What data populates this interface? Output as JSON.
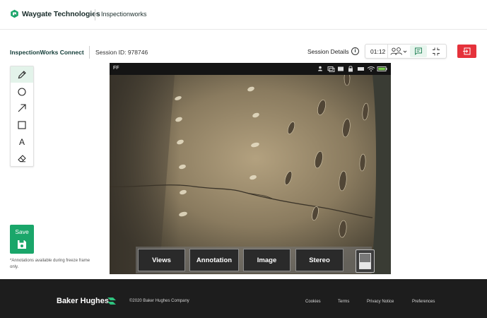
{
  "header": {
    "brand": "Waygate Technologies",
    "app_name": "Inspectionworks"
  },
  "session": {
    "title": "InspectionWorks Connect",
    "session_id": "Session ID: 978746",
    "details_label": "Session Details",
    "timer": "01:12"
  },
  "tools": [
    {
      "icon": "pencil-icon",
      "active": true
    },
    {
      "icon": "circle-icon"
    },
    {
      "icon": "arrow-icon"
    },
    {
      "icon": "rectangle-icon"
    },
    {
      "icon": "text-icon",
      "label": "A"
    },
    {
      "icon": "eraser-icon"
    }
  ],
  "save": {
    "label": "Save",
    "note": "*Annotations available during freeze frame only."
  },
  "video": {
    "status_text": "FF",
    "menu": [
      "Views",
      "Annotation",
      "Image",
      "Stereo"
    ]
  },
  "footer": {
    "brand": "Baker Hughes",
    "copyright": "©2020 Baker Hughes Company",
    "links": [
      "Cookies",
      "Terms",
      "Privacy Notice",
      "Preferences"
    ]
  },
  "colors": {
    "accent_green": "#1aa66a",
    "exit_red": "#e5323b",
    "footer_bg": "#1d1d1d"
  }
}
